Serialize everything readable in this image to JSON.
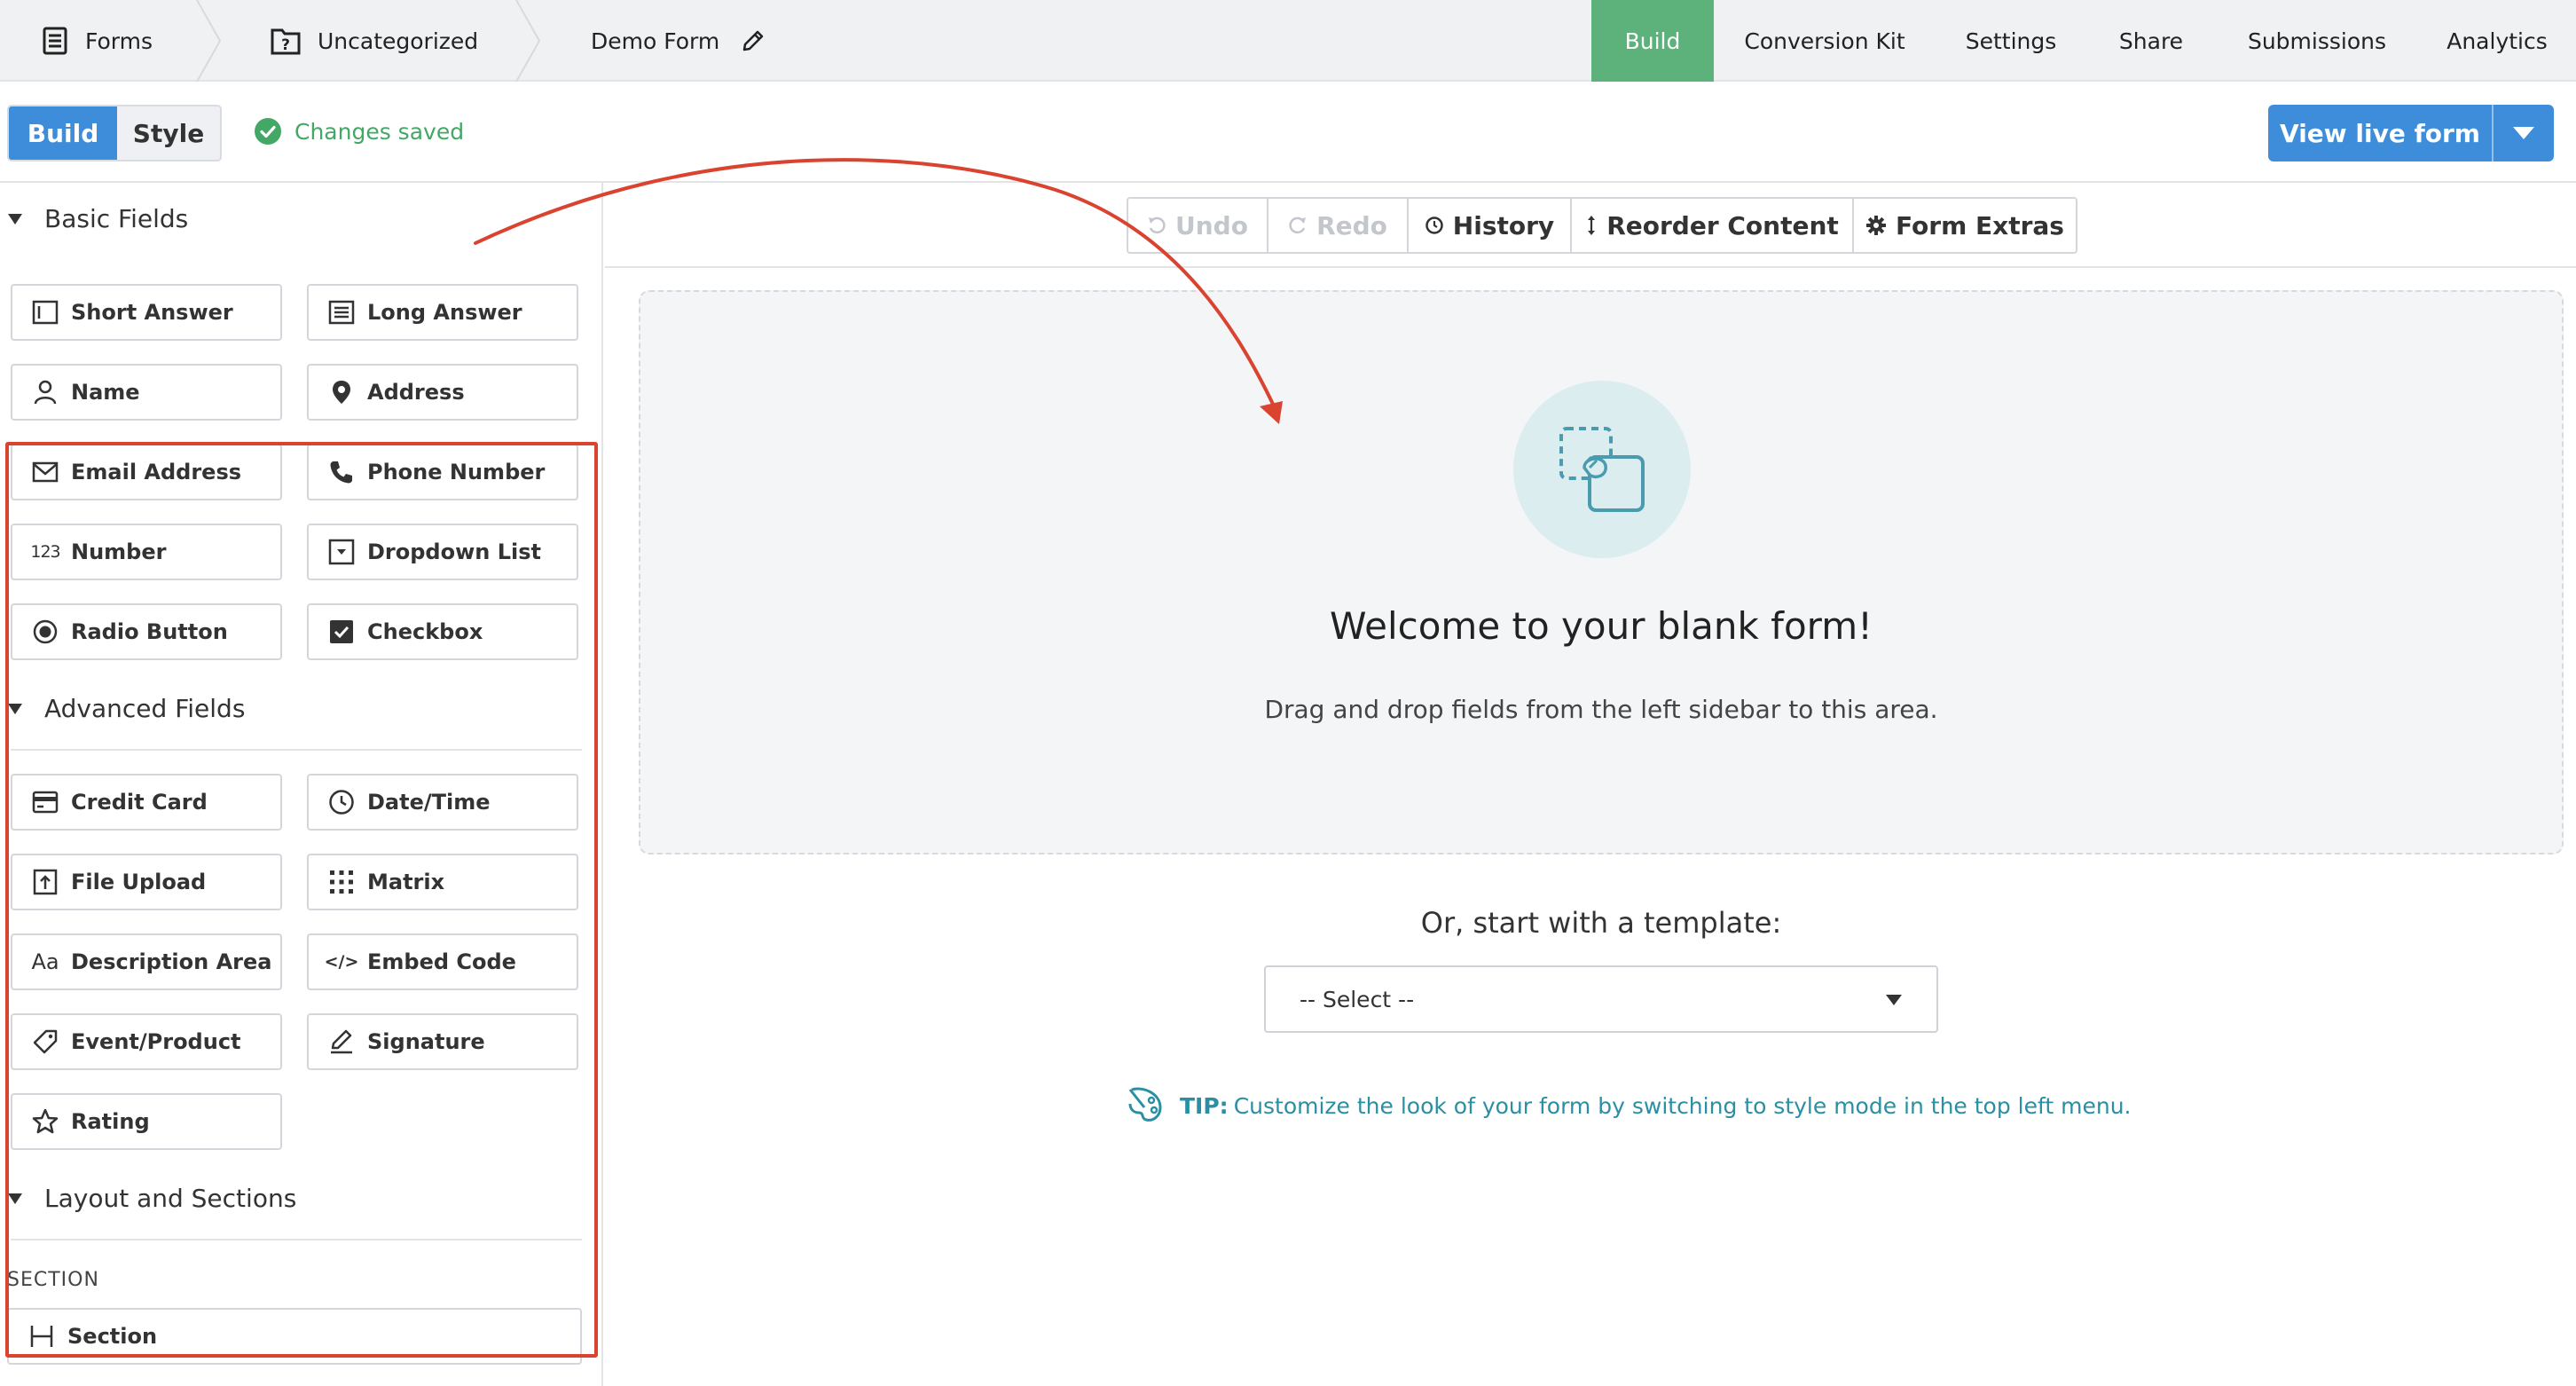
{
  "breadcrumb": {
    "forms": "Forms",
    "folder": "Uncategorized",
    "form_name": "Demo Form"
  },
  "tabs": [
    "Build",
    "Conversion Kit",
    "Settings",
    "Share",
    "Submissions",
    "Analytics"
  ],
  "active_tab": "Build",
  "mode_toggle": {
    "build": "Build",
    "style": "Style",
    "active": "Build"
  },
  "status": "Changes saved",
  "view_live_form": "View live form",
  "sidebar": {
    "basic_title": "Basic Fields",
    "basic_fields": [
      {
        "label": "Short Answer",
        "icon": "short-answer-icon"
      },
      {
        "label": "Long Answer",
        "icon": "long-answer-icon"
      },
      {
        "label": "Name",
        "icon": "person-icon"
      },
      {
        "label": "Address",
        "icon": "map-pin-icon"
      },
      {
        "label": "Email Address",
        "icon": "envelope-icon"
      },
      {
        "label": "Phone Number",
        "icon": "phone-icon"
      },
      {
        "label": "Number",
        "icon": "123",
        "icon_text": "123"
      },
      {
        "label": "Dropdown List",
        "icon": "dropdown-icon"
      },
      {
        "label": "Radio Button",
        "icon": "radio-icon"
      },
      {
        "label": "Checkbox",
        "icon": "checkbox-icon"
      }
    ],
    "advanced_title": "Advanced Fields",
    "advanced_fields": [
      {
        "label": "Credit Card",
        "icon": "credit-card-icon"
      },
      {
        "label": "Date/Time",
        "icon": "clock-icon"
      },
      {
        "label": "File Upload",
        "icon": "file-upload-icon"
      },
      {
        "label": "Matrix",
        "icon": "matrix-icon"
      },
      {
        "label": "Description Area",
        "icon": "Aa",
        "icon_text": "Aa"
      },
      {
        "label": "Embed Code",
        "icon": "code-icon",
        "icon_text": "</>"
      },
      {
        "label": "Event/Product",
        "icon": "tag-icon"
      },
      {
        "label": "Signature",
        "icon": "signature-pen-icon"
      },
      {
        "label": "Rating",
        "icon": "star-icon"
      }
    ],
    "layout_title": "Layout and Sections",
    "section_label": "SECTION",
    "section_field": "Section"
  },
  "toolbar": {
    "undo": "Undo",
    "redo": "Redo",
    "history": "History",
    "reorder": "Reorder Content",
    "extras": "Form Extras"
  },
  "canvas": {
    "title": "Welcome to your blank form!",
    "subtitle": "Drag and drop fields from the left sidebar to this area."
  },
  "template": {
    "label": "Or, start with a template:",
    "select_value": "-- Select --"
  },
  "tip": {
    "prefix": "TIP:",
    "text": "Customize the look of your form by switching to style mode in the top left menu."
  },
  "colors": {
    "primary_blue": "#3d8ddb",
    "active_tab_green": "#5cb27a",
    "saved_green": "#43a765",
    "tip_teal": "#2a8fa3",
    "annotation_red": "#d9432f"
  }
}
